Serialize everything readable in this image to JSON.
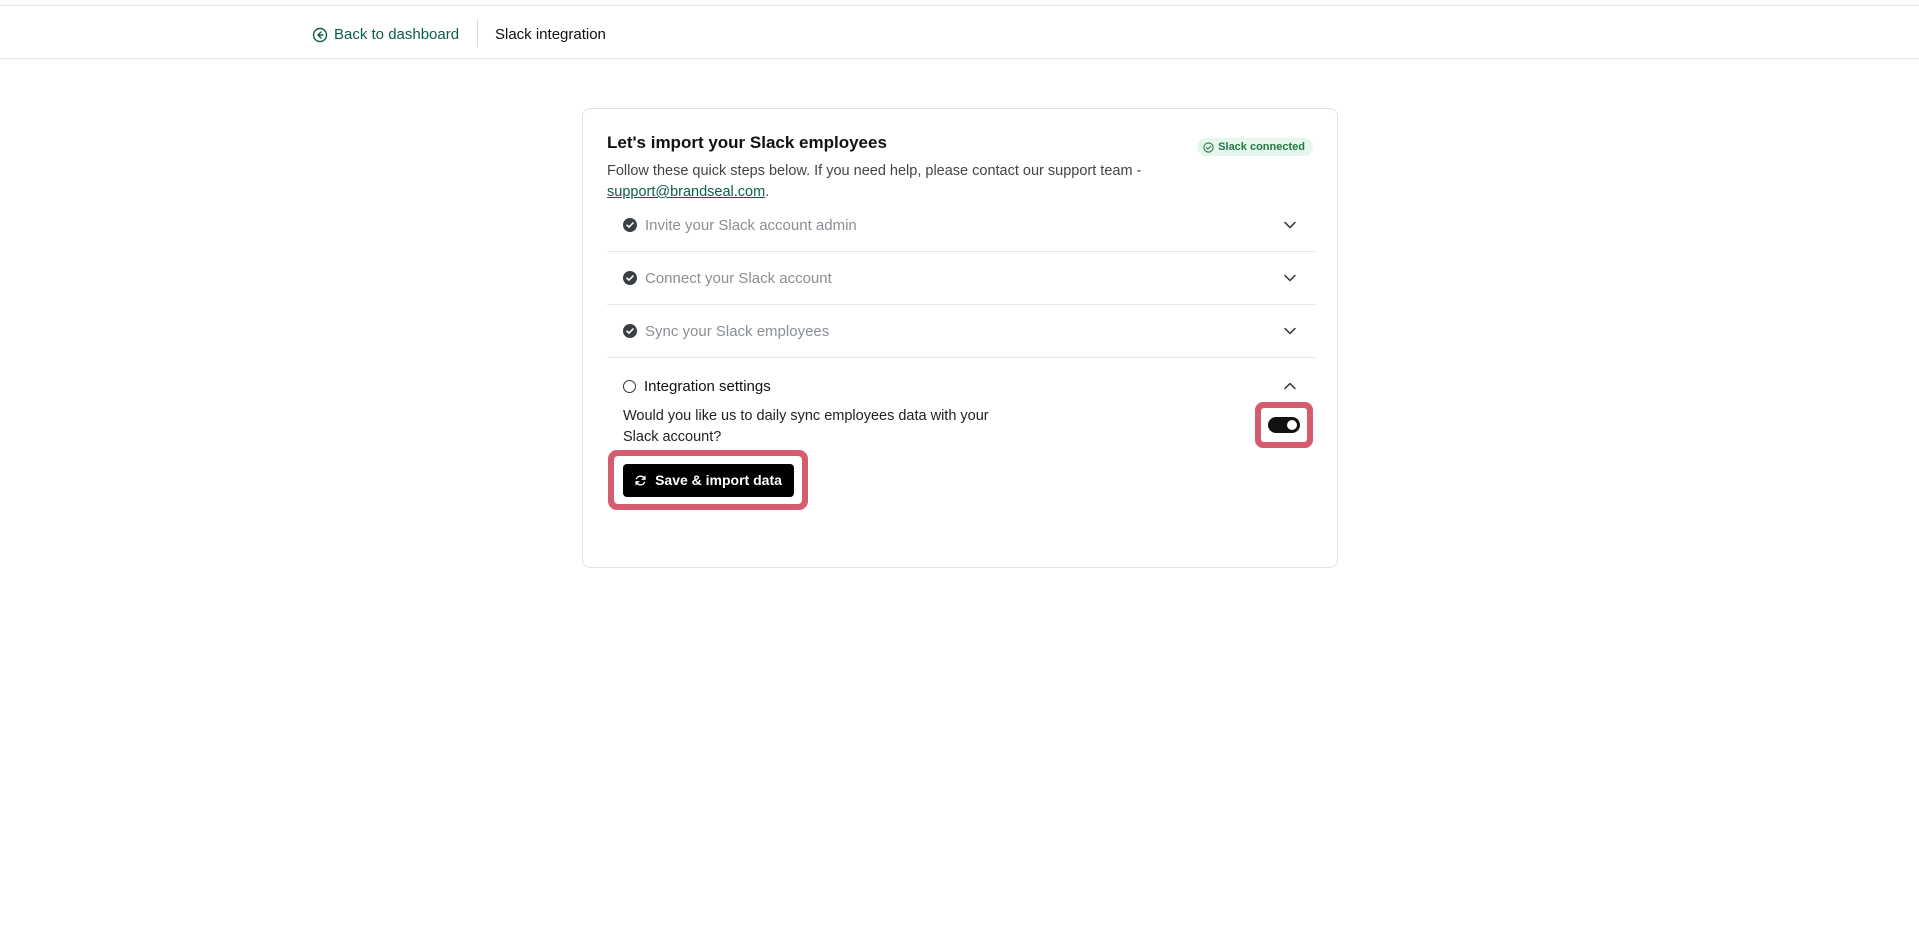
{
  "header": {
    "back_label": "Back to dashboard",
    "title": "Slack integration"
  },
  "card": {
    "title": "Let's import your Slack employees",
    "badge": "Slack connected",
    "desc_text": "Follow these quick steps below. If you need help, please contact our support team - ",
    "support_email": "support@brandseal.com",
    "desc_end": "."
  },
  "steps": [
    {
      "label": "Invite your Slack account admin",
      "done": true
    },
    {
      "label": "Connect your Slack account",
      "done": true
    },
    {
      "label": "Sync your Slack employees",
      "done": true
    }
  ],
  "settings": {
    "label": "Integration settings",
    "question": "Would you like us to daily sync employees data with your Slack account?",
    "toggle_on": true,
    "button_label": "Save & import data"
  },
  "colors": {
    "accent": "#0d5c4a",
    "highlight": "#d45c6e",
    "badge_bg": "#e6f6ec",
    "badge_fg": "#1f7a45"
  }
}
